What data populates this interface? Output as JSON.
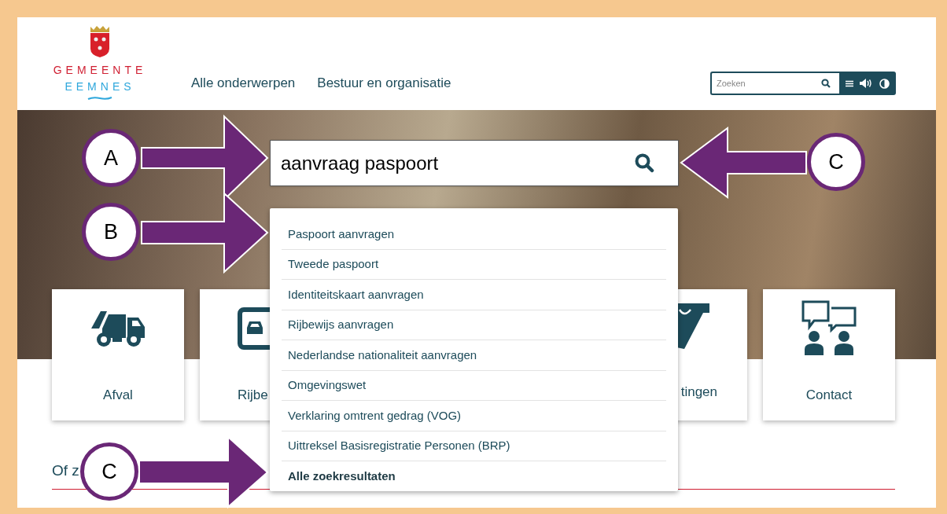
{
  "header": {
    "logo": {
      "line_1": "GEMEENTE",
      "line_2": "EEMNES"
    },
    "nav": [
      {
        "label": "Alle onderwerpen"
      },
      {
        "label": "Bestuur en organisatie"
      }
    ],
    "search": {
      "placeholder": "Zoeken"
    }
  },
  "hero_search": {
    "value": "aanvraag paspoort"
  },
  "suggestions": [
    {
      "label": "Paspoort aanvragen",
      "kind": "suggestion"
    },
    {
      "label": "Tweede paspoort",
      "kind": "suggestion"
    },
    {
      "label": "Identiteitskaart aanvragen",
      "kind": "suggestion"
    },
    {
      "label": "Rijbewijs aanvragen",
      "kind": "suggestion"
    },
    {
      "label": "Nederlandse nationaliteit aanvragen",
      "kind": "suggestion"
    },
    {
      "label": "Omgevingswet",
      "kind": "suggestion"
    },
    {
      "label": "Verklaring omtrent gedrag (VOG)",
      "kind": "suggestion"
    },
    {
      "label": "Uittreksel Basisregistratie Personen (BRP)",
      "kind": "suggestion"
    },
    {
      "label": "Alle zoekresultaten",
      "kind": "all_results"
    }
  ],
  "tiles": [
    {
      "label": "Afval",
      "kind": "truck"
    },
    {
      "label": "Rijbe",
      "kind": "car"
    },
    {
      "label": "tingen",
      "kind": "sign"
    },
    {
      "label": "Contact",
      "kind": "contact"
    }
  ],
  "section_heading": "Of z",
  "annotations": [
    {
      "label": "A"
    },
    {
      "label": "C"
    },
    {
      "label": "B"
    },
    {
      "label": "C"
    }
  ]
}
